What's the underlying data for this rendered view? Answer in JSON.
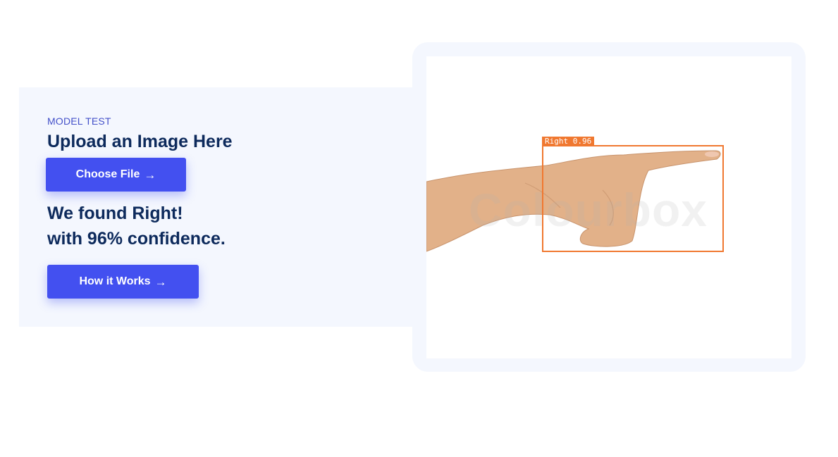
{
  "section": {
    "eyebrow": "MODEL TEST",
    "title": "Upload an Image Here",
    "choose_button_label": "Choose File",
    "result_line_1": "We found Right!",
    "result_line_2": "with 96% confidence.",
    "how_button_label": "How it Works"
  },
  "preview": {
    "watermark_text": "Colourbox",
    "detection_label": "Right  0.96",
    "detection_color": "#f07830"
  },
  "colors": {
    "accent": "#4350f0",
    "heading": "#0d2a5c",
    "panel_bg": "#f4f7fe"
  }
}
